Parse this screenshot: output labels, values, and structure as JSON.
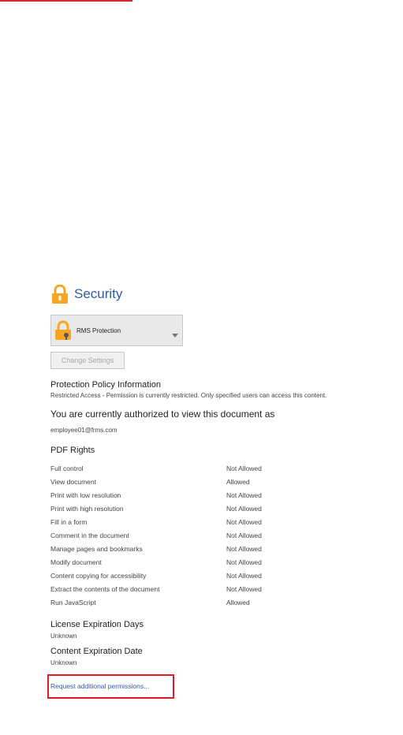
{
  "colors": {
    "accent_red": "#d9262b",
    "title_blue": "#2f5ba4",
    "lock_orange": "#f6a623",
    "link_highlight": "#e21b24"
  },
  "security": {
    "title": "Security",
    "title_icon": "lock-icon",
    "protection_dropdown": {
      "selected": "RMS Protection",
      "icon": "rms-lock-icon"
    },
    "change_settings_label": "Change Settings"
  },
  "policy": {
    "heading": "Protection Policy Information",
    "text": "Restricted Access - Permission is currently restricted. Only specified users can access this content."
  },
  "authorization": {
    "heading": "You are currently authorized to view this document as",
    "user": "employee01@frms.com"
  },
  "pdf_rights": {
    "heading": "PDF Rights",
    "rows": [
      {
        "name": "Full control",
        "value": "Not Allowed"
      },
      {
        "name": "View document",
        "value": "Allowed"
      },
      {
        "name": "Print with low resolution",
        "value": "Not Allowed"
      },
      {
        "name": "Print with high resolution",
        "value": "Not Allowed"
      },
      {
        "name": "Fill in a form",
        "value": "Not Allowed"
      },
      {
        "name": "Comment in the document",
        "value": "Not Allowed"
      },
      {
        "name": "Manage pages and bookmarks",
        "value": "Not Allowed"
      },
      {
        "name": "Modify document",
        "value": "Not Allowed"
      },
      {
        "name": "Content copying for accessibility",
        "value": "Not Allowed"
      },
      {
        "name": "Extract the contents of the document",
        "value": "Not Allowed"
      },
      {
        "name": "Run JavaScript",
        "value": "Allowed"
      }
    ]
  },
  "license": {
    "heading": "License Expiration Days",
    "value": "Unknown"
  },
  "content_expiration": {
    "heading": "Content Expiration Date",
    "value": "Unknown"
  },
  "request_link": "Request additional permissions..."
}
